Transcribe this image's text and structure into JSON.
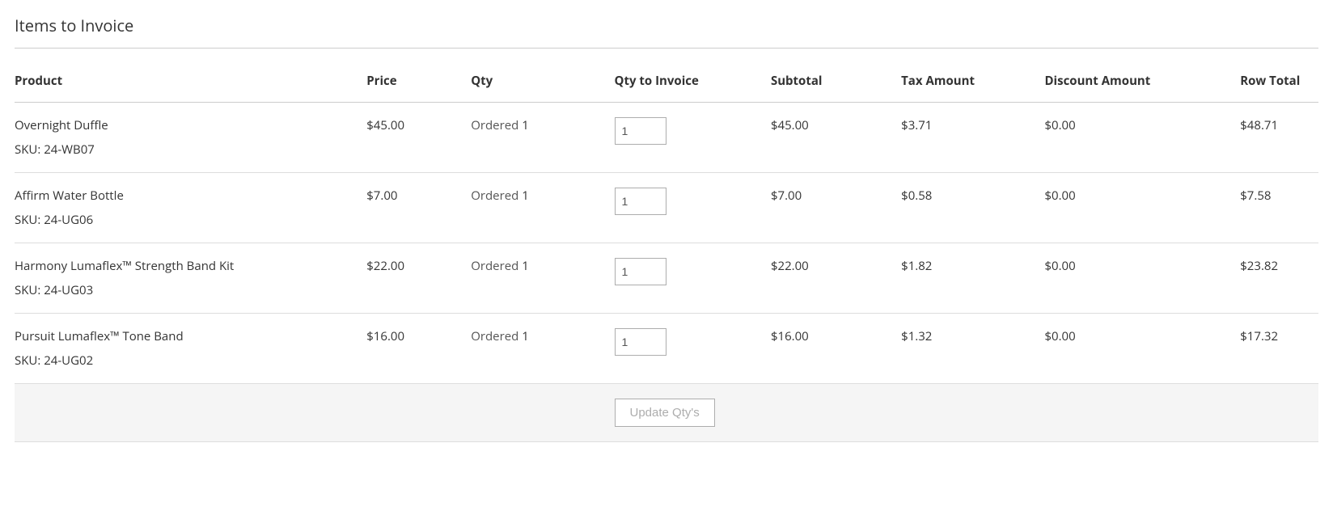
{
  "section": {
    "title": "Items to Invoice"
  },
  "columns": {
    "product": "Product",
    "price": "Price",
    "qty": "Qty",
    "qty_to_invoice": "Qty to Invoice",
    "subtotal": "Subtotal",
    "tax_amount": "Tax Amount",
    "discount_amount": "Discount Amount",
    "row_total": "Row Total"
  },
  "labels": {
    "sku_prefix": "SKU: ",
    "ordered_prefix": "Ordered ",
    "update_qtys": "Update Qty's"
  },
  "items": [
    {
      "name": "Overnight Duffle",
      "sku": "24-WB07",
      "price": "$45.00",
      "qty_ordered": "1",
      "qty_to_invoice": "1",
      "subtotal": "$45.00",
      "tax": "$3.71",
      "discount": "$0.00",
      "row_total": "$48.71"
    },
    {
      "name": "Affirm Water Bottle",
      "sku": "24-UG06",
      "price": "$7.00",
      "qty_ordered": "1",
      "qty_to_invoice": "1",
      "subtotal": "$7.00",
      "tax": "$0.58",
      "discount": "$0.00",
      "row_total": "$7.58"
    },
    {
      "name": "Harmony Lumaflex™ Strength Band Kit",
      "sku": "24-UG03",
      "price": "$22.00",
      "qty_ordered": "1",
      "qty_to_invoice": "1",
      "subtotal": "$22.00",
      "tax": "$1.82",
      "discount": "$0.00",
      "row_total": "$23.82"
    },
    {
      "name": "Pursuit Lumaflex™ Tone Band",
      "sku": "24-UG02",
      "price": "$16.00",
      "qty_ordered": "1",
      "qty_to_invoice": "1",
      "subtotal": "$16.00",
      "tax": "$1.32",
      "discount": "$0.00",
      "row_total": "$17.32"
    }
  ]
}
